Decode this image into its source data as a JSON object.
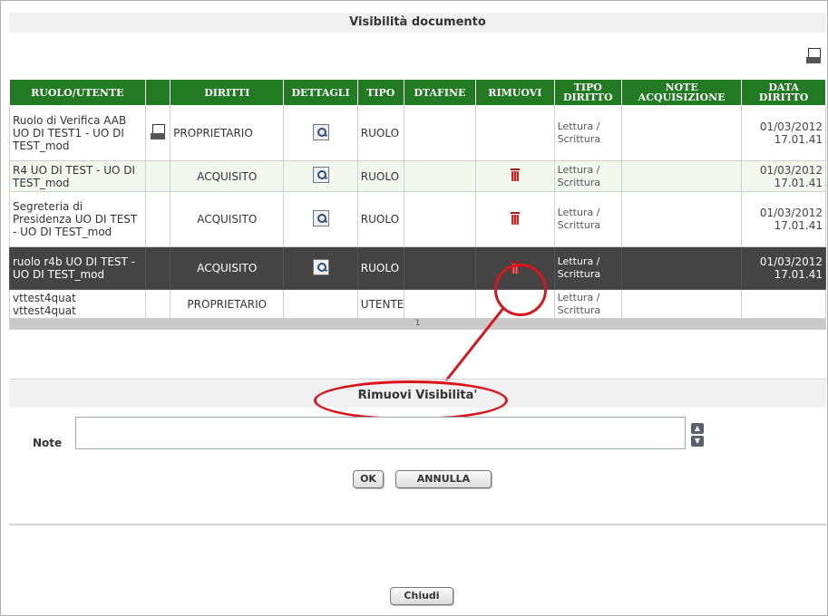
{
  "dialog_title": "Visibilità documento",
  "table": {
    "headers": [
      "RUOLO/UTENTE",
      "",
      "DIRITTI",
      "DETTAGLI",
      "TIPO",
      "DTAFINE",
      "RIMUOVI",
      "TIPO DIRITTO",
      "NOTE ACQUISIZIONE",
      "DATA DIRITTO"
    ],
    "rows": [
      {
        "ruolo": "Ruolo di Verifica AAB UO DI TEST1 - UO DI TEST_mod",
        "diritti": "PROPRIETARIO",
        "tipo": "RUOLO",
        "tipo_diritto": "Lettura / Scrittura",
        "data_diritto": "01/03/2012 17.01.41"
      },
      {
        "ruolo": "R4 UO DI TEST - UO DI TEST_mod",
        "diritti": "ACQUISITO",
        "tipo": "RUOLO",
        "tipo_diritto": "Lettura / Scrittura",
        "data_diritto": "01/03/2012 17.01.41"
      },
      {
        "ruolo": "Segreteria di Presidenza UO DI TEST - UO DI TEST_mod",
        "diritti": "ACQUISITO",
        "tipo": "RUOLO",
        "tipo_diritto": "Lettura / Scrittura",
        "data_diritto": "01/03/2012 17.01.41"
      },
      {
        "ruolo": "ruolo r4b UO DI TEST - UO DI TEST_mod",
        "diritti": "ACQUISITO",
        "tipo": "RUOLO",
        "tipo_diritto": "Lettura / Scrittura",
        "data_diritto": "01/03/2012 17.01.41"
      },
      {
        "ruolo": "vttest4quat vttest4quat",
        "diritti": "PROPRIETARIO",
        "tipo": "UTENTE",
        "tipo_diritto": "Lettura / Scrittura",
        "data_diritto": ""
      }
    ],
    "page": "1"
  },
  "remove_panel": {
    "title": "Rimuovi Visibilita'",
    "note_label": "Note",
    "note_value": "",
    "ok_label": "OK",
    "cancel_label": "ANNULLA"
  },
  "close_label": "Chiudi",
  "icons": {
    "print": "print-icon",
    "details": "magnifier-icon",
    "remove": "trash-icon",
    "document": "document-icon"
  },
  "colors": {
    "header_green": "#227a22",
    "selected_row": "#444444",
    "highlight_red": "#d9141b"
  }
}
